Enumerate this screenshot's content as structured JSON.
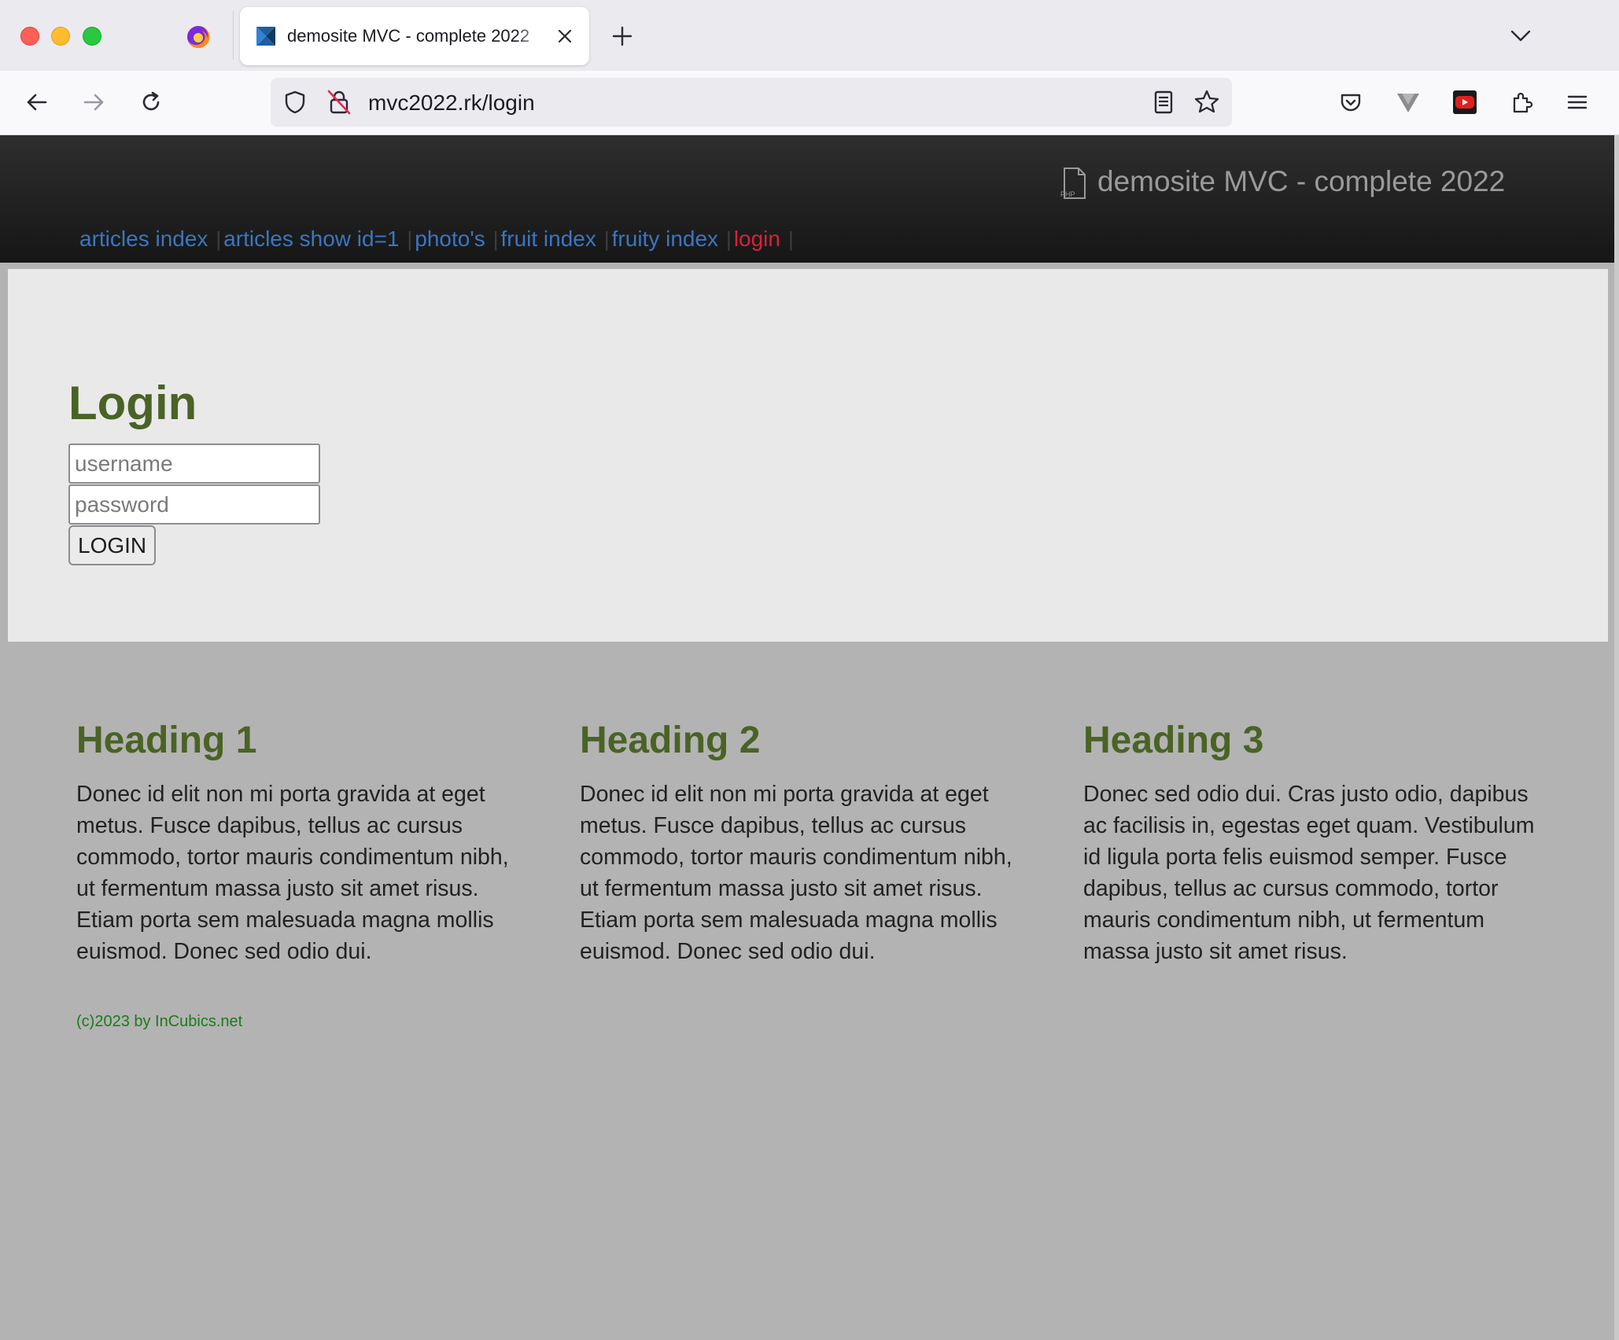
{
  "browser": {
    "tab_title": "demosite MVC - complete 2022",
    "url": "mvc2022.rk/login"
  },
  "site": {
    "title": "demosite MVC - complete 2022",
    "menu": [
      {
        "label": "articles index"
      },
      {
        "label": "articles show id=1"
      },
      {
        "label": "photo's"
      },
      {
        "label": "fruit index"
      },
      {
        "label": "fruity index"
      },
      {
        "label": "login"
      }
    ],
    "active_color": "#d9223a",
    "link_color": "#3a76c2"
  },
  "login": {
    "heading": "Login",
    "username_placeholder": "username",
    "password_placeholder": "password",
    "button_label": "LOGIN"
  },
  "columns": [
    {
      "heading": "Heading 1",
      "text": "Donec id elit non mi porta gravida at eget metus. Fusce dapibus, tellus ac cursus commodo, tortor mauris condimentum nibh, ut fermentum massa justo sit amet risus. Etiam porta sem malesuada magna mollis euismod. Donec sed odio dui."
    },
    {
      "heading": "Heading 2",
      "text": "Donec id elit non mi porta gravida at eget metus. Fusce dapibus, tellus ac cursus commodo, tortor mauris condimentum nibh, ut fermentum massa justo sit amet risus. Etiam porta sem malesuada magna mollis euismod. Donec sed odio dui."
    },
    {
      "heading": "Heading 3",
      "text": "Donec sed odio dui. Cras justo odio, dapibus ac facilisis in, egestas eget quam. Vestibulum id ligula porta felis euismod semper. Fusce dapibus, tellus ac cursus commodo, tortor mauris condimentum nibh, ut fermentum massa justo sit amet risus."
    }
  ],
  "footer": {
    "text": "(c)2023 by InCubics.net"
  },
  "icons": {
    "browser_logo": "firefox-icon",
    "favicon": "site-favicon-icon",
    "back": "back-arrow-icon",
    "forward": "forward-arrow-icon",
    "reload": "reload-icon",
    "tracking": "shield-icon",
    "insecure": "insecure-lock-icon",
    "reader": "reader-view-icon",
    "bookmark": "star-icon",
    "pocket": "pocket-icon",
    "vivaldi_ext": "v-extension-icon",
    "youtube_ext": "youtube-extension-icon",
    "extensions": "puzzle-icon",
    "menu": "hamburger-menu-icon",
    "php": "php-file-icon"
  }
}
